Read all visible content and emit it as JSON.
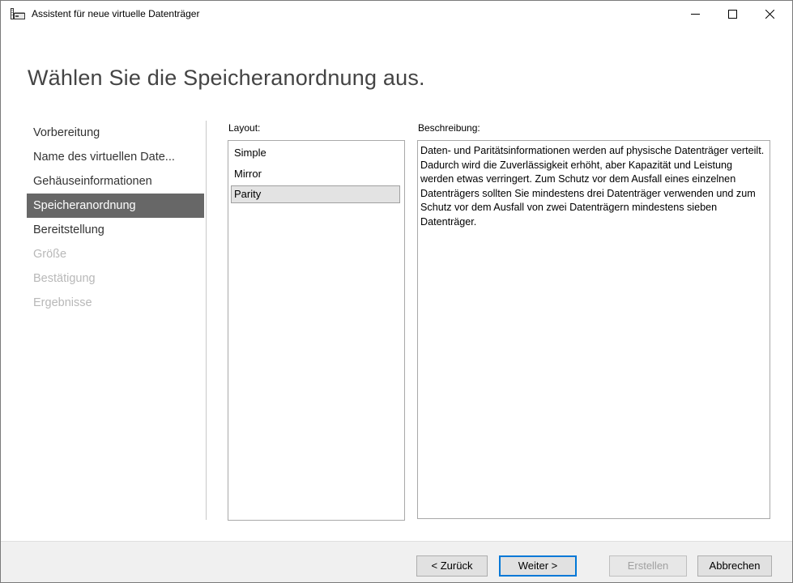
{
  "window": {
    "title": "Assistent für neue virtuelle Datenträger",
    "icon": "wizard-drive-icon",
    "controls": {
      "minimize": "minimize-icon",
      "maximize": "maximize-icon",
      "close": "close-icon"
    }
  },
  "page": {
    "heading": "Wählen Sie die Speicheranordnung aus."
  },
  "nav": {
    "items": [
      {
        "label": "Vorbereitung",
        "state": "normal"
      },
      {
        "label": "Name des virtuellen Date...",
        "state": "normal"
      },
      {
        "label": "Gehäuseinformationen",
        "state": "normal"
      },
      {
        "label": "Speicheranordnung",
        "state": "selected"
      },
      {
        "label": "Bereitstellung",
        "state": "normal"
      },
      {
        "label": "Größe",
        "state": "disabled"
      },
      {
        "label": "Bestätigung",
        "state": "disabled"
      },
      {
        "label": "Ergebnisse",
        "state": "disabled"
      }
    ]
  },
  "layout": {
    "label": "Layout:",
    "options": [
      "Simple",
      "Mirror",
      "Parity"
    ],
    "selected": "Parity"
  },
  "description": {
    "label": "Beschreibung:",
    "text": "Daten- und Paritätsinformationen werden auf physische Datenträger verteilt. Dadurch wird die Zuverlässigkeit erhöht, aber Kapazität und Leistung werden etwas verringert. Zum Schutz vor dem Ausfall eines einzelnen Datenträgers sollten Sie mindestens drei Datenträger verwenden und zum Schutz vor dem Ausfall von zwei Datenträgern mindestens sieben Datenträger."
  },
  "footer": {
    "back_label": "< Zurück",
    "next_label": "Weiter >",
    "create_label": "Erstellen",
    "cancel_label": "Abbrechen"
  },
  "colors": {
    "nav_selected_bg": "#676767",
    "default_button_border": "#0078d7",
    "footer_bg": "#f0f0f0"
  }
}
